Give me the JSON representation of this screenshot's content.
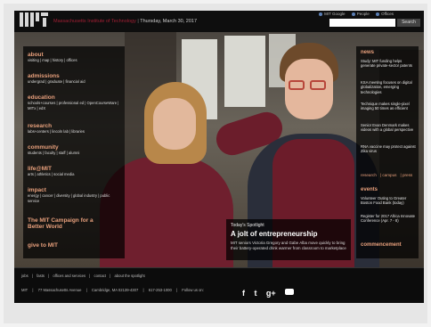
{
  "header": {
    "institute": "Massachusetts Institute of Technology",
    "date": "Thursday, March 30, 2017",
    "links": [
      "MIT Google",
      "People",
      "Offices"
    ],
    "search_placeholder": "",
    "search_button": "Search"
  },
  "nav": [
    {
      "head": "about",
      "links": "visiting | map | history | offices"
    },
    {
      "head": "admissions",
      "links": "undergrad | graduate | financial aid"
    },
    {
      "head": "education",
      "links": "schools+courses | professional ed | OpenCourseWare | MITx | edX"
    },
    {
      "head": "research",
      "links": "labs+centers | lincoln lab | libraries"
    },
    {
      "head": "community",
      "links": "students | faculty | staff | alumni"
    },
    {
      "head": "life@MIT",
      "links": "arts | athletics | social media"
    },
    {
      "head": "impact",
      "links": "energy | cancer | diversity | global industry | public service"
    },
    {
      "head": "The MIT Campaign for a Better World",
      "links": ""
    },
    {
      "head": "give to MIT",
      "links": ""
    }
  ],
  "news": {
    "head": "news",
    "items": [
      "Study: MIT funding helps generate private-sector patents",
      "KSA meeting focuses on digital globalization, emerging technologies",
      "Technique makes single-pixel imaging 50 times as efficient",
      "Senior Evan Denmark makes videos with a global perspective",
      "RNA vaccine may protect against Zika virus"
    ],
    "links": [
      "research",
      "campus",
      "press"
    ]
  },
  "events": {
    "head": "events",
    "items": [
      "Volunteer Outing to Greater Boston Food Bank (today)",
      "Register for 2017 Africa Innovate Conference (Apr. 7 - 8)"
    ]
  },
  "commencement": "commencement",
  "spotlight": {
    "label": "Today's Spotlight",
    "title": "A jolt of entrepreneurship",
    "desc": "MIT seniors Victoria Gregory and Gabe Alba move quickly to bring their battery-operated drink warmer from classroom to marketplace"
  },
  "footer": {
    "links": [
      "jobs",
      "|",
      "fasts",
      "|",
      "offices and services",
      "|",
      "contact",
      "|",
      "about the spotlight"
    ],
    "address": [
      "MIT",
      "|",
      "77 Massachusetts Avenue",
      "|",
      "Cambridge, MA 02139-4307",
      "|",
      "617-253-1000",
      "|",
      "Follow us on:"
    ],
    "social": [
      "f",
      "t",
      "g+"
    ]
  }
}
